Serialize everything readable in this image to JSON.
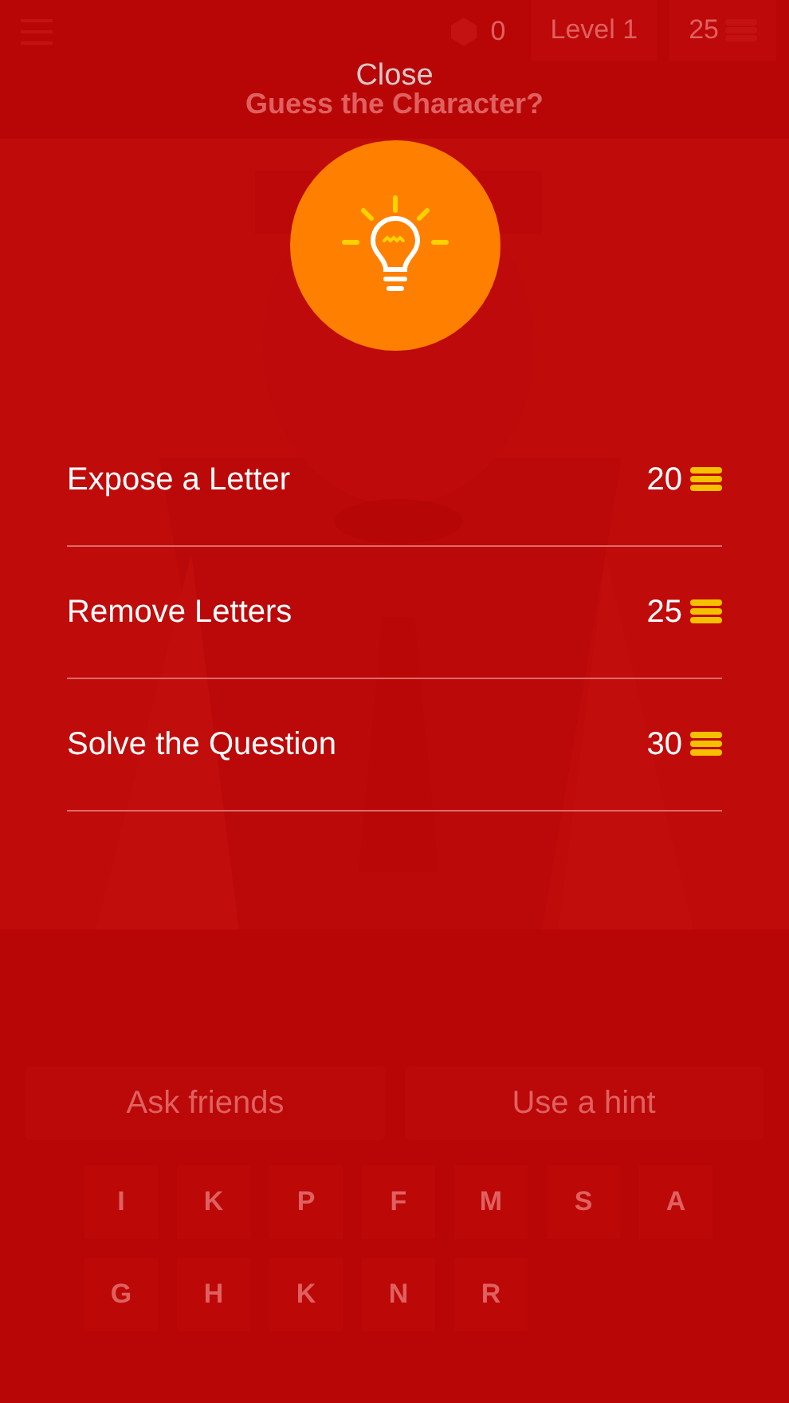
{
  "top_bar": {
    "score": "0",
    "level": "Level 1",
    "coins": "25"
  },
  "title": "Guess the Character?",
  "buttons": [
    "Ask friends",
    "Use a hint"
  ],
  "letter_keys": [
    [
      "I",
      "K",
      "P",
      "F",
      "M",
      "S",
      "A"
    ],
    [
      "G",
      "H",
      "K",
      "N",
      "R"
    ]
  ],
  "hint_dialog": {
    "close": "Close",
    "options": [
      {
        "label": "Expose a Letter",
        "cost": "20"
      },
      {
        "label": "Remove Letters",
        "cost": "25"
      },
      {
        "label": "Solve the Question",
        "cost": "30"
      }
    ]
  }
}
